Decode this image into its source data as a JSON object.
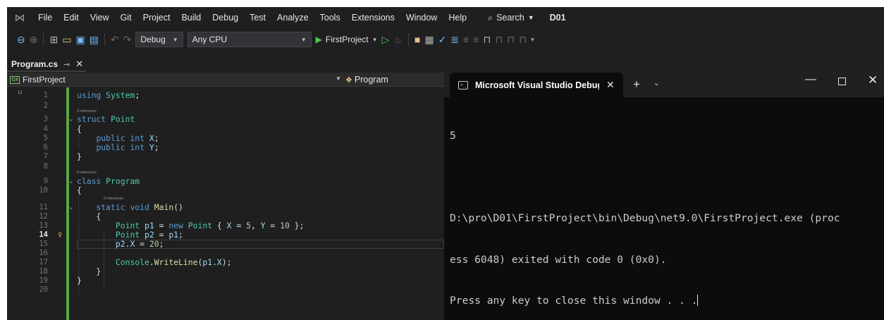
{
  "menubar": {
    "items": [
      "File",
      "Edit",
      "View",
      "Git",
      "Project",
      "Build",
      "Debug",
      "Test",
      "Analyze",
      "Tools",
      "Extensions",
      "Window",
      "Help"
    ],
    "search_label": "Search",
    "solution_name": "D01"
  },
  "toolbar": {
    "configuration": "Debug",
    "platform": "Any CPU",
    "startup_project": "FirstProject"
  },
  "editor": {
    "tab_label": "Program.cs",
    "nav_project": "FirstProject",
    "nav_class": "Program",
    "active_line": "14",
    "line_numbers": [
      "1",
      "2",
      "3",
      "4",
      "5",
      "6",
      "7",
      "8",
      "9",
      "10",
      "11",
      "12",
      "13",
      "14",
      "15",
      "16",
      "17",
      "18",
      "19",
      "20"
    ],
    "refs_struct": "3 references",
    "refs_class": "0 references",
    "refs_main": "0 references"
  },
  "console": {
    "title": "Microsoft Visual Studio Debug Console",
    "output_line1": "5",
    "output_line2": "D:\\pro\\D01\\FirstProject\\bin\\Debug\\net9.0\\FirstProject.exe (proc",
    "output_line3": "ess 6048) exited with code 0 (0x0).",
    "output_line4": "Press any key to close this window . . ."
  }
}
